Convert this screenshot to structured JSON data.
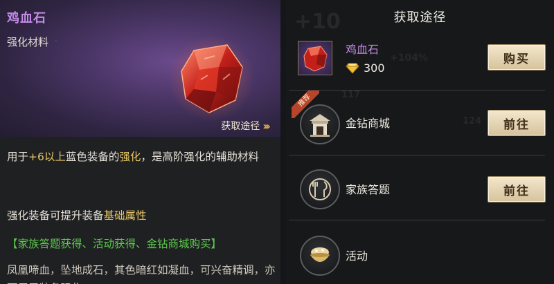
{
  "item": {
    "name": "鸡血石",
    "type": "强化材料",
    "source_link": "获取途径",
    "description": {
      "p1": "用于",
      "p2": "+6以上",
      "p3": "蓝色装备的",
      "p4": "强化",
      "p5": "，是高阶强化的辅助材料"
    },
    "bonus": {
      "p1": "强化装备可提升装备",
      "p2": "基础属性"
    },
    "obtain": "【家族答题获得、活动获得、金钻商城购买】",
    "lore": "凤凰啼血，坠地成石，其色暗红如凝血，可兴奋精调，亦可用于装备强化"
  },
  "panel": {
    "title": "获取途径",
    "purchase": {
      "name": "鸡血石",
      "price": "300",
      "button": "购买"
    },
    "sources": [
      {
        "name": "金钻商城",
        "tag": "推荐",
        "button": "前往"
      },
      {
        "name": "家族答题",
        "button": "前往"
      },
      {
        "name": "活动"
      }
    ],
    "background_text": {
      "a": "+10",
      "b": "+104%",
      "c": "117",
      "d": "124"
    }
  },
  "colors": {
    "item_name": "#c48be6",
    "highlight": "#e8c766",
    "obtain": "#5cc84e",
    "button_bg": "#e6d6b2"
  },
  "icons": [
    "gem-icon",
    "diamond-icon",
    "shop-icon",
    "quiz-icon",
    "event-icon",
    "chevron-right-icon"
  ]
}
